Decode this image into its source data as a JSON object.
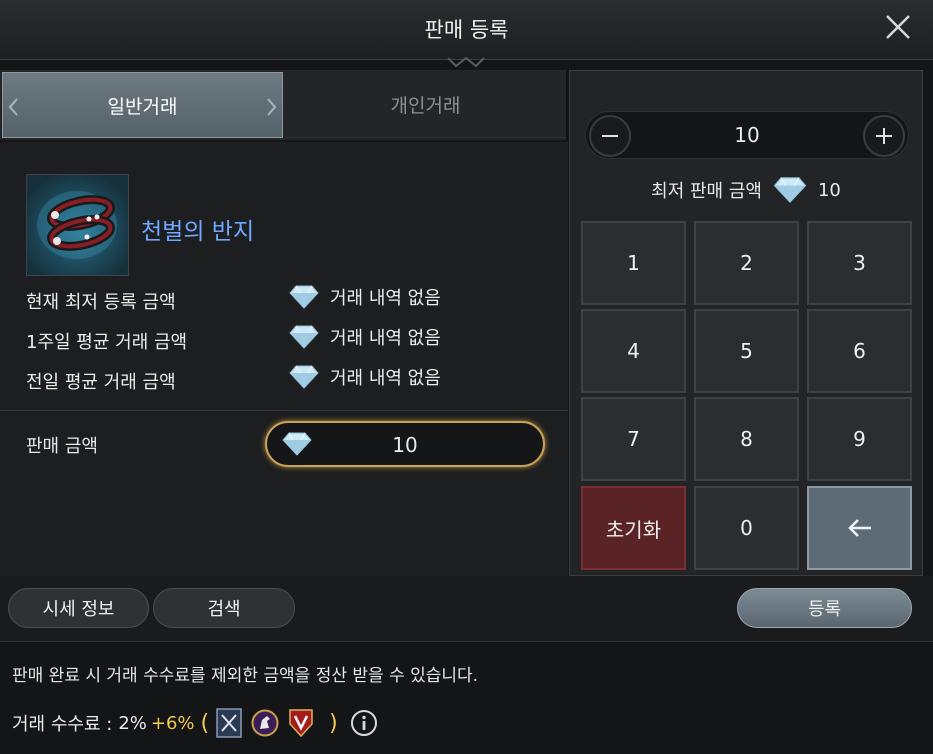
{
  "window": {
    "title": "판매 등록",
    "close_icon": "close-icon"
  },
  "tabs": [
    {
      "label": "일반거래",
      "active": true
    },
    {
      "label": "개인거래",
      "active": false
    }
  ],
  "item": {
    "name": "천벌의 반지",
    "icon": "ring-icon",
    "name_color": "#6fa8ff"
  },
  "info": [
    {
      "label": "현재 최저 등록 금액",
      "value": "거래 내역 없음",
      "icon": "diamond-icon"
    },
    {
      "label": "1주일 평균 거래 금액",
      "value": "거래 내역 없음",
      "icon": "diamond-icon"
    },
    {
      "label": "전일 평균 거래 금액",
      "value": "거래 내역 없음",
      "icon": "diamond-icon"
    }
  ],
  "price": {
    "label": "판매 금액",
    "value": "10"
  },
  "stepper": {
    "value": "10",
    "minus_icon": "minus-icon",
    "plus_icon": "plus-icon"
  },
  "min_price": {
    "label": "최저 판매 금액",
    "value": "10"
  },
  "keypad": {
    "keys": [
      "1",
      "2",
      "3",
      "4",
      "5",
      "6",
      "7",
      "8",
      "9"
    ],
    "reset": "초기화",
    "zero": "0",
    "back_icon": "arrow-left-icon"
  },
  "buttons": {
    "market": "시세 정보",
    "search": "검색",
    "register": "등록"
  },
  "notice": "판매 완료 시 거래 수수료를 제외한 금액을 정산 받을 수 있습니다.",
  "fee": {
    "label": "거래 수수료 :",
    "base": "2%",
    "bonus": "+6%",
    "open_paren": "(",
    "close_paren": ")",
    "icons": [
      "guild-banner-icon",
      "horse-emblem-icon",
      "v-shield-icon"
    ],
    "info_icon": "info-icon"
  },
  "colors": {
    "accent_gold": "#c8a25a",
    "bonus_yellow": "#f3c94f",
    "reset_red": "#5a2325",
    "active_tab": "#6e7a82"
  }
}
